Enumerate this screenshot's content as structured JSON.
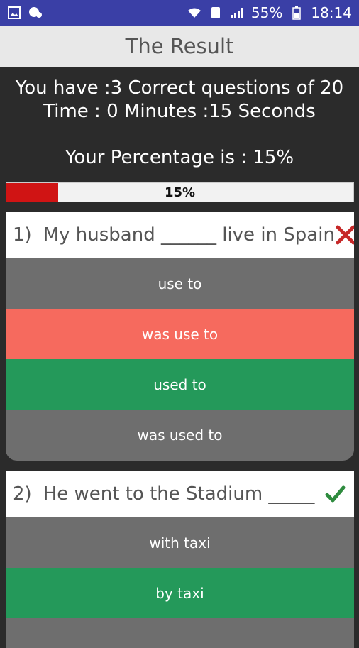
{
  "status_bar": {
    "battery": "55%",
    "time": "18:14"
  },
  "header": {
    "title": "The Result"
  },
  "summary": {
    "line1": "You have :3 Correct questions of 20",
    "line2": "Time : 0 Minutes :15 Seconds",
    "percentage_text": "Your Percentage is : 15%",
    "progress_value": 0.15,
    "progress_label": "15%"
  },
  "colors": {
    "wrong": "#f66a5e",
    "correct": "#24995a",
    "neutral": "#6e6e6e",
    "progress": "#d01414"
  },
  "questions": [
    {
      "number": "1)",
      "text": "My husband ______ live in Spain",
      "result_icon": "cross-icon",
      "options": [
        "use to",
        "was use to",
        "used to",
        "was used to"
      ]
    },
    {
      "number": "2)",
      "text": "He went to the Stadium _____",
      "result_icon": "check-icon",
      "options": [
        "with taxi",
        "by taxi"
      ]
    }
  ]
}
